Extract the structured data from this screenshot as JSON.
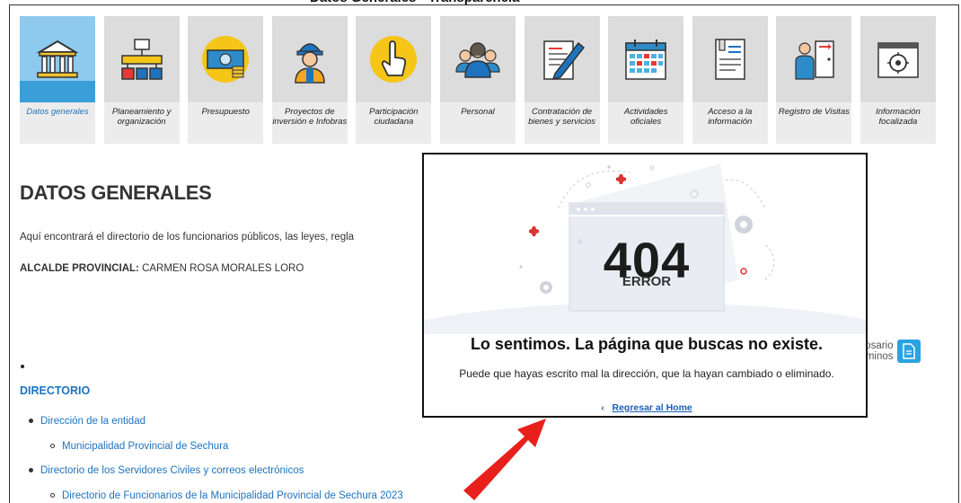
{
  "nav": {
    "items": [
      {
        "label": "Datos generales",
        "icon": "building-icon",
        "active": true
      },
      {
        "label": "Planeamiento y\norganización",
        "icon": "org-chart-icon"
      },
      {
        "label": "Presupuesto",
        "icon": "money-icon"
      },
      {
        "label": "Proyectos de\ninversión e Infobras",
        "icon": "worker-icon"
      },
      {
        "label": "Participación\nciudadana",
        "icon": "hand-pointer-icon"
      },
      {
        "label": "Personal",
        "icon": "people-icon"
      },
      {
        "label": "Contratación de\nbienes y servicios",
        "icon": "contract-pen-icon"
      },
      {
        "label": "Actividades\noficiales",
        "icon": "calendar-icon"
      },
      {
        "label": "Acceso a la\ninformación",
        "icon": "document-icon"
      },
      {
        "label": "Registro de Visitas",
        "icon": "visitor-icon"
      },
      {
        "label": "Información\nfocalizada",
        "icon": "target-window-icon"
      }
    ]
  },
  "main": {
    "title": "DATOS GENERALES",
    "intro": "Aquí encontrará el directorio de los funcionarios públicos, las leyes, regla",
    "mayor_label": "ALCALDE PROVINCIAL:",
    "mayor_name": " CARMEN ROSA MORALES LORO",
    "directory_heading": "DIRECTORIO",
    "list": [
      {
        "text": "Dirección de la entidad",
        "level": 1
      },
      {
        "text": "Municipalidad Provincial de Sechura",
        "level": 2
      },
      {
        "text": "Directorio de los Servidores Civiles y correos electrónicos",
        "level": 1
      },
      {
        "text": "Directorio de Funcionarios de la Municipalidad Provincial de Sechura 2023",
        "level": 2
      }
    ]
  },
  "glosario": {
    "line1": "losario",
    "line2": "rminos"
  },
  "error_modal": {
    "code": "404",
    "word": "ERROR",
    "title": "Lo sentimos. La página que buscas no existe.",
    "message": "Puede que hayas escrito mal la dirección, que la hayan cambiado o eliminado.",
    "link_arrow": "‹",
    "link_text": "Regresar al Home"
  },
  "colors": {
    "accent": "#1e73be",
    "arrow": "#e8201c",
    "active_tile": "#3a9fd8"
  }
}
